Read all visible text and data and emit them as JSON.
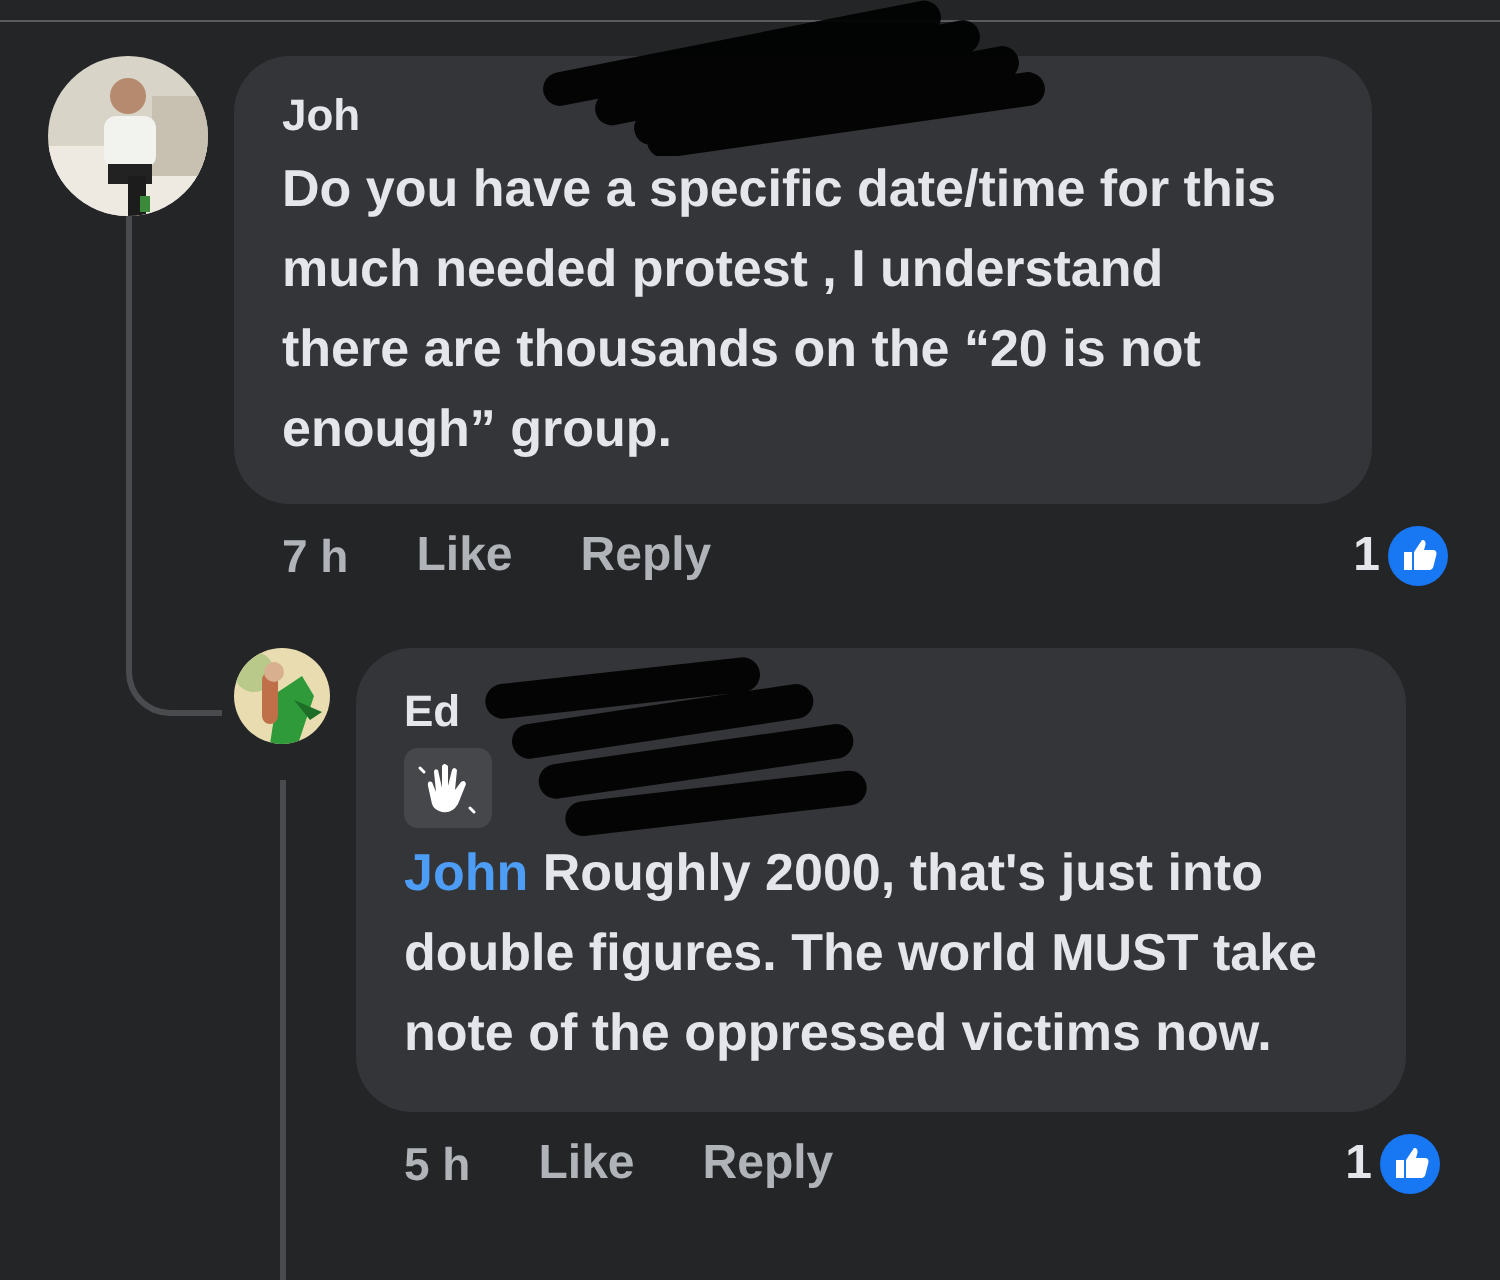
{
  "comments": [
    {
      "author": "Joh",
      "text": "Do you have a specific date/time for this much needed protest , I understand there are thousands on the “20 is not enough” group.",
      "time": "7 h",
      "actions": [
        "Like",
        "Reply"
      ],
      "reaction_count": "1",
      "replies": [
        {
          "author": "Ed",
          "mention": "John",
          "text": "Roughly 2000, that's just into double figures. The world MUST take note of the oppressed victims now.",
          "time": "5 h",
          "actions": [
            "Like",
            "Reply"
          ],
          "reaction_count": "1"
        }
      ]
    }
  ]
}
